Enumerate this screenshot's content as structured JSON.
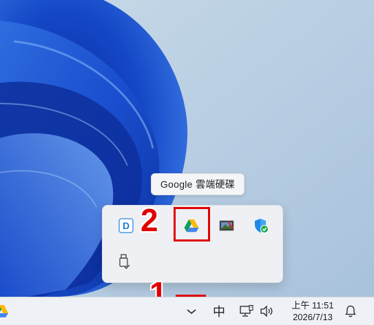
{
  "tooltip": {
    "text": "Google 雲端硬碟"
  },
  "annotations": {
    "step1": "1",
    "step2": "2"
  },
  "tray_icons": [
    {
      "name": "dictionary-app-icon",
      "letter": "D"
    },
    {
      "name": "google-drive-icon"
    },
    {
      "name": "image-app-icon"
    },
    {
      "name": "security-shield-icon"
    },
    {
      "name": "usb-device-icon"
    }
  ],
  "taskbar": {
    "ime_label": "中",
    "clock_time": "上午 11:51",
    "clock_date": "2026/7/13"
  },
  "colors": {
    "annotation_red": "#e00000",
    "wallpaper_blue": "#1546c8"
  }
}
